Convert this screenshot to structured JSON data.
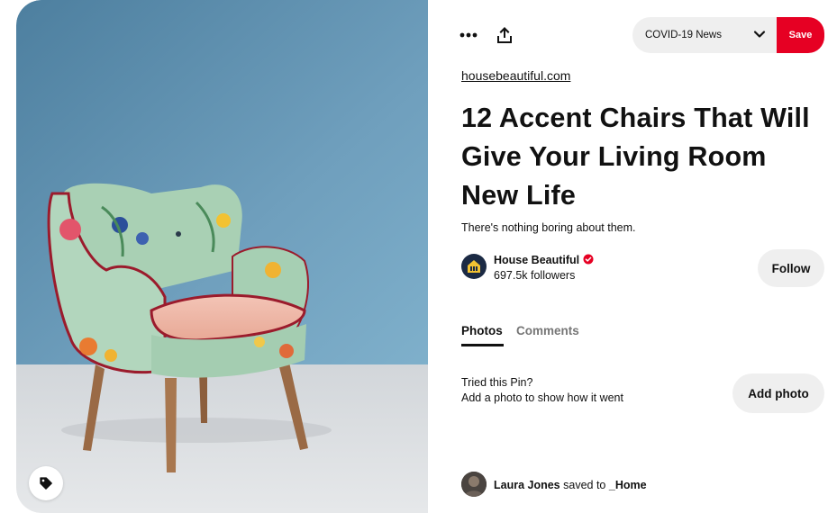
{
  "toolbar": {
    "more_icon": "more-dots-icon",
    "share_icon": "share-upload-icon",
    "board_select_value": "COVID-19 News",
    "save_label": "Save"
  },
  "image": {
    "tag_icon": "tag-icon"
  },
  "pin": {
    "source": "housebeautiful.com",
    "title": "12 Accent Chairs That Will Give Your Living Room New Life",
    "description": "There's nothing boring about them."
  },
  "creator": {
    "name": "House Beautiful",
    "followers": "697.5k followers",
    "follow_label": "Follow"
  },
  "tabs": {
    "photos": "Photos",
    "comments": "Comments"
  },
  "tried": {
    "line1": "Tried this Pin?",
    "line2": "Add a photo to show how it went",
    "add_photo_label": "Add photo"
  },
  "saved_by": {
    "name": "Laura Jones",
    "saved_to": "saved to",
    "board": "_Home"
  },
  "colors": {
    "save_red": "#e60023",
    "wall_blue": "#5b8fae",
    "floor_grey": "#d9dcdf"
  }
}
